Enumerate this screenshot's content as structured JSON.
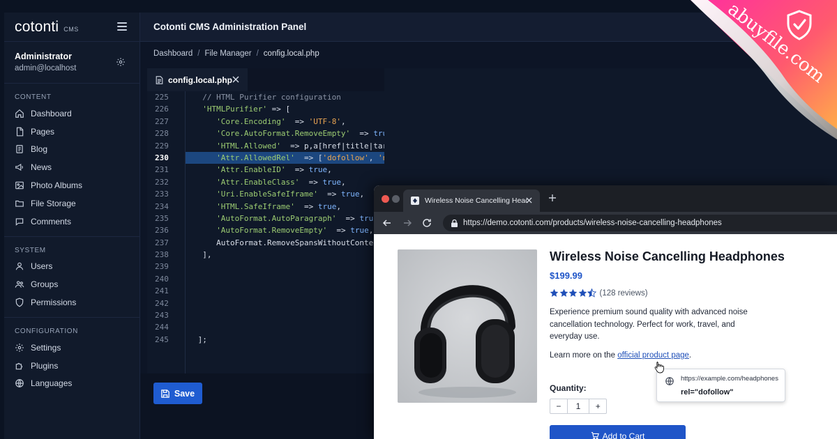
{
  "brand": {
    "name": "cotonti",
    "sub": "CMS"
  },
  "user": {
    "name": "Administrator",
    "email": "admin@localhost"
  },
  "sidebar": {
    "sections": [
      {
        "heading": "CONTENT",
        "items": [
          {
            "label": "Dashboard",
            "icon": "home-icon"
          },
          {
            "label": "Pages",
            "icon": "page-icon"
          },
          {
            "label": "Blog",
            "icon": "document-icon"
          },
          {
            "label": "News",
            "icon": "megaphone-icon"
          },
          {
            "label": "Photo Albums",
            "icon": "image-icon"
          },
          {
            "label": "File Storage",
            "icon": "folder-icon"
          },
          {
            "label": "Comments",
            "icon": "comment-icon"
          }
        ]
      },
      {
        "heading": "SYSTEM",
        "items": [
          {
            "label": "Users",
            "icon": "user-icon"
          },
          {
            "label": "Groups",
            "icon": "users-icon"
          },
          {
            "label": "Permissions",
            "icon": "shield-icon"
          }
        ]
      },
      {
        "heading": "CONFIGURATION",
        "items": [
          {
            "label": "Settings",
            "icon": "gear-icon"
          },
          {
            "label": "Plugins",
            "icon": "puzzle-icon"
          },
          {
            "label": "Languages",
            "icon": "globe-icon"
          }
        ]
      }
    ]
  },
  "header": {
    "title": "Cotonti CMS Administration Panel"
  },
  "breadcrumb": {
    "items": [
      "Dashboard",
      "File Manager",
      "config.local.php"
    ],
    "separator": "/"
  },
  "editor": {
    "tab_label": "config.local.php",
    "active_line": 230,
    "line_numbers": [
      "225",
      "226",
      "227",
      "228",
      "229",
      "230",
      "231",
      "232",
      "233",
      "234",
      "235",
      "236",
      "237",
      "238",
      "239",
      "240",
      "241",
      "242",
      "243",
      "244",
      "245"
    ],
    "code_lines": [
      "  // HTML Purifier configuration",
      "  'HTMLPurifier' => [",
      "     'Core.Encoding'  => 'UTF-8',",
      "     'Core.AutoFormat.RemoveEmpty'  => true,",
      "     'HTML.Allowed'  => 'p,a[href|title|target|rel],strong,em,ul,ol,li,br,blockquote,code,pre,img[",
      "     'Attr.AllowedRel'  => ['dofollow', 'nofollow', 'noreferer', 'noopener', 'external', 'ugc', 'sponsored'],",
      "     'Attr.EnableID'  => true,",
      "     'Attr.EnableClass'  => true,",
      "     'Uri.EnableSafeIframe'  => true,",
      "     'HTML.SafeIframe'  => true,",
      "     'AutoFormat.AutoParagraph'  => true,",
      "     'AutoFormat.RemoveEmpty'  => true,",
      "     'AutoFormat.RemoveSpansWithoutConte",
      "  ],",
      "",
      "",
      "",
      "",
      "",
      "",
      " ];"
    ]
  },
  "actions": {
    "save_label": "Save"
  },
  "browser": {
    "tab_title": "Wireless Noise Cancelling Headphones",
    "url": "https://demo.cotonti.com/products/wireless-noise-cancelling-headphones",
    "product": {
      "title": "Wireless Noise Cancelling Headphones",
      "price": "$199.99",
      "rating": 4.5,
      "reviews": "(128 reviews)",
      "description": "Experience premium sound quality with advanced noise cancellation technology. Perfect for work, travel, and everyday use.",
      "learn_more_prefix": "Learn more on the",
      "learn_more_link": "official product page",
      "learn_more_suffix": ".",
      "quantity_label": "Quantity:",
      "quantity_value": "1",
      "qty_minus": "−",
      "qty_plus": "+",
      "add_to_cart": "Add to Cart"
    },
    "tooltip": {
      "url": "https://example.com/headphones",
      "rel": "rel=\"dofollow\""
    }
  },
  "watermark": {
    "text": "abuyfile.com"
  },
  "colors": {
    "accent": "#1f5cd1",
    "link": "#1f4fb8",
    "highlight": "#1c477f",
    "watermark_start": "#ff2ea0",
    "watermark_end": "#ffb347"
  }
}
